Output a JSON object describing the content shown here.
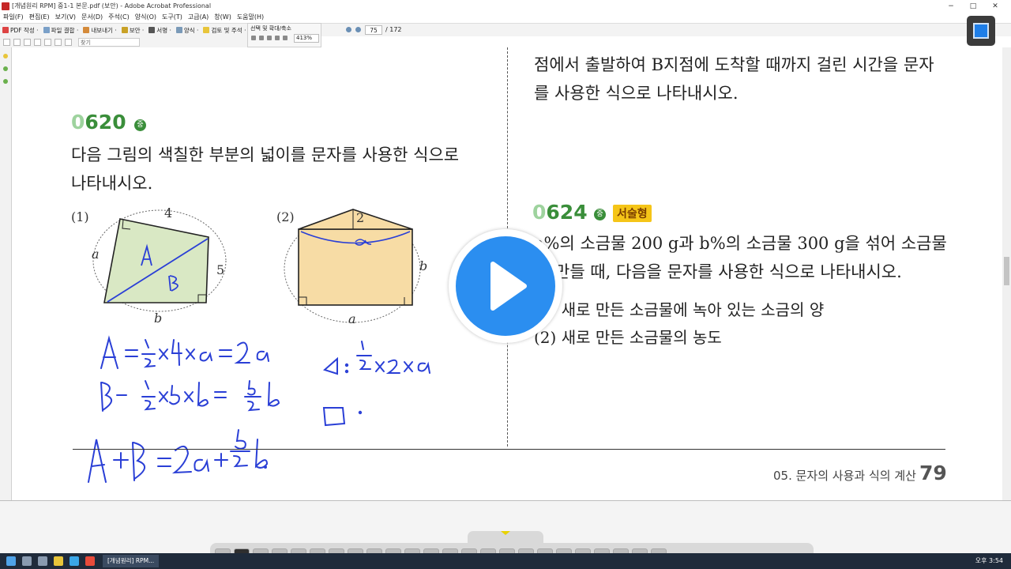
{
  "window": {
    "title": "[개념원리 RPM] 중1-1 본문.pdf (보안) - Adobe Acrobat Professional"
  },
  "menu": [
    "파일(F)",
    "편집(E)",
    "보기(V)",
    "문서(D)",
    "주석(C)",
    "양식(O)",
    "도구(T)",
    "고급(A)",
    "창(W)",
    "도움말(H)"
  ],
  "toolbar": {
    "pdf_create": "PDF 작성 ·",
    "file_combine": "파일 결합 ·",
    "export": "내보내기 ·",
    "security": "보안 ·",
    "sign": "서명 ·",
    "forms": "양식 ·",
    "review": "검토 및 주석 ·",
    "zoom_group_label": "선택 및 확대/축소",
    "zoom_value": "413%",
    "page_current": "75",
    "page_total": "/ 172",
    "search_placeholder": "찾기"
  },
  "document": {
    "right_top_line1": "점에서 출발하여 B지점에 도착할 때까지 걸린 시간을 문자",
    "right_top_line2": "를 사용한 식으로 나타내시오.",
    "q620": {
      "num_first": "0",
      "num_rest": "620",
      "difficulty": "중",
      "line1": "다음 그림의 색칠한 부분의 넓이를 문자를 사용한 식으로",
      "line2": "나타내시오.",
      "fig1_label": "(1)",
      "fig2_label": "(2)",
      "fig1_top": "4",
      "fig1_left": "a",
      "fig1_right": "5",
      "fig1_bottom": "b",
      "fig2_top": "2",
      "fig2_right": "b",
      "fig2_bottom": "a"
    },
    "q624": {
      "num_first": "0",
      "num_rest": "624",
      "difficulty": "중",
      "tag": "서술형",
      "line1": "a%의 소금물 200 g과 b%의 소금물 300 g을 섞어 소금물",
      "line2": "을 만들 때, 다음을 문자를 사용한 식으로 나타내시오.",
      "item1": "(1) 새로 만든 소금물에 녹아 있는 소금의 양",
      "item2": "(2) 새로 만든 소금물의 농도"
    },
    "footer_section": "05. 문자의 사용과 식의 계산",
    "footer_page": "79"
  },
  "taskbar": {
    "app_label": "[개념원리] RPM...",
    "clock": "오후 3:54"
  },
  "colors": {
    "accent_green": "#3a8e3a",
    "shape_green": "#d9e8c4",
    "shape_tan": "#f7dca5",
    "ink_blue": "#2a3fd6",
    "play_blue": "#2b8ef0"
  }
}
